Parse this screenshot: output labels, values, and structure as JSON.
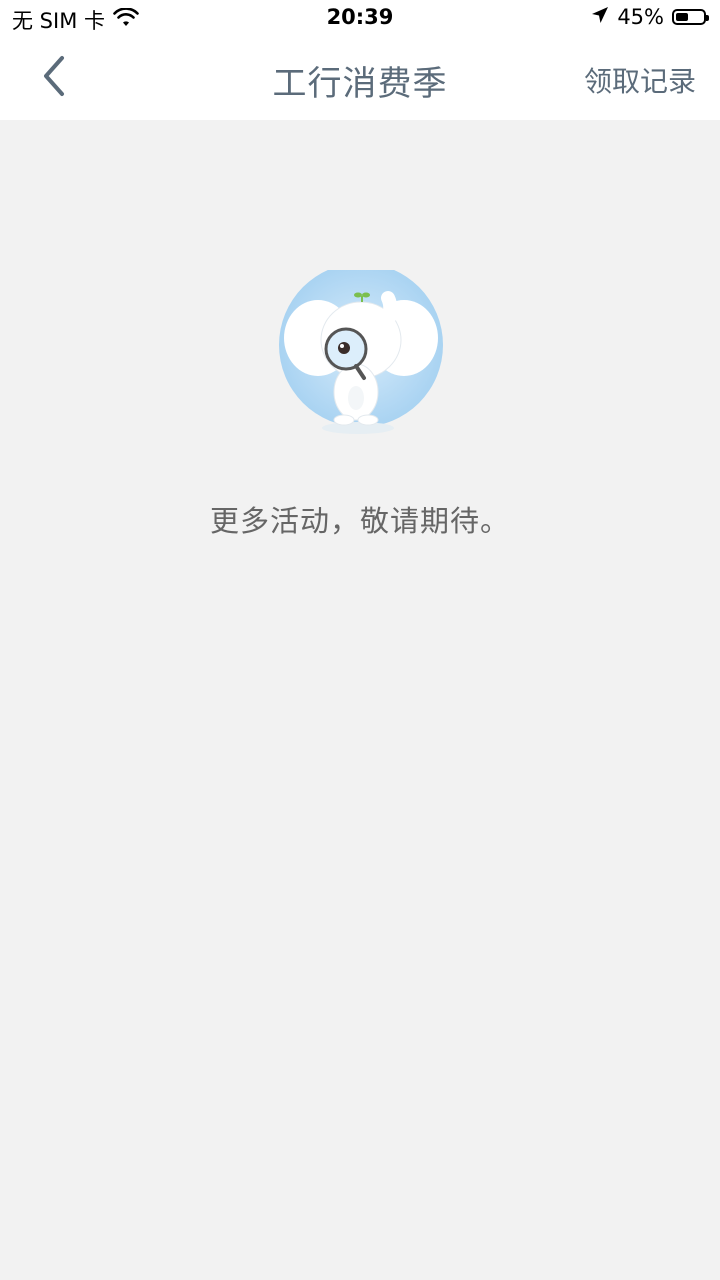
{
  "status_bar": {
    "carrier": "无 SIM 卡",
    "time": "20:39",
    "battery": "45%",
    "battery_level": 0.45
  },
  "nav": {
    "title": "工行消费季",
    "action": "领取记录"
  },
  "empty_state": {
    "message": "更多活动，敬请期待。"
  },
  "colors": {
    "nav_text": "#5b6b7a",
    "background": "#f2f2f2",
    "illustration_circle": "#b9dcf4"
  },
  "icons": [
    "wifi-icon",
    "location-arrow-icon",
    "battery-icon",
    "back-chevron-icon",
    "elephant-mascot-illustration"
  ]
}
